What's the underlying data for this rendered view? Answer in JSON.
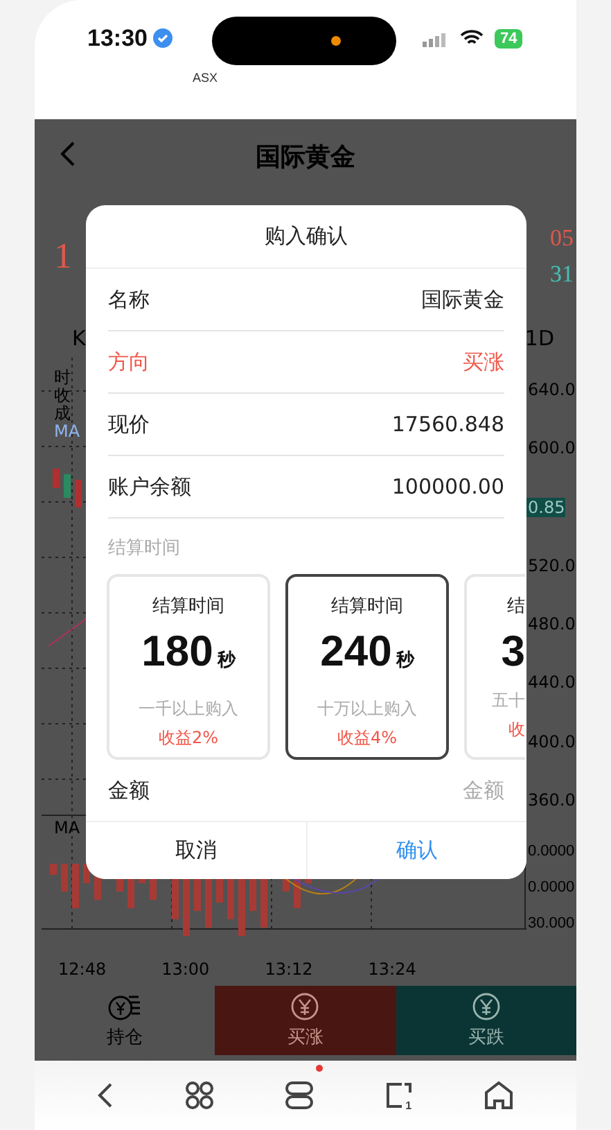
{
  "status_bar": {
    "time": "13:30",
    "battery": "74",
    "carrier_label": "ASX"
  },
  "background": {
    "title": "国际黄金",
    "price_fragment": "1",
    "change_fragments": [
      {
        "text": "05",
        "color": "#e0584c"
      },
      {
        "text": "31",
        "color": "#45c0b4"
      }
    ],
    "period_left": "K",
    "period_right": "1D",
    "info_labels": [
      "时",
      "收",
      "成",
      "MA"
    ],
    "axis_upper": [
      {
        "text": "640.0",
        "kind": "plain"
      },
      {
        "text": "600.0",
        "kind": "plain"
      },
      {
        "text": "0.85",
        "kind": "tag"
      },
      {
        "text": "520.0",
        "kind": "plain"
      },
      {
        "text": "480.0",
        "kind": "plain"
      },
      {
        "text": "440.0",
        "kind": "plain"
      },
      {
        "text": "400.0",
        "kind": "plain"
      },
      {
        "text": "360.0",
        "kind": "plain"
      }
    ],
    "axis_lower": [
      "0.0000",
      "0.0000",
      "30.000"
    ],
    "lower_label": "MA",
    "times": [
      "12:48",
      "13:00",
      "13:12",
      "13:24"
    ],
    "actions": [
      {
        "label": "持仓",
        "kind": "holdings"
      },
      {
        "label": "买涨",
        "kind": "up"
      },
      {
        "label": "买跌",
        "kind": "down"
      }
    ]
  },
  "dialog": {
    "title": "购入确认",
    "rows": [
      {
        "label": "名称",
        "value": "国际黄金",
        "highlight": false
      },
      {
        "label": "方向",
        "value": "买涨",
        "highlight": true
      },
      {
        "label": "现价",
        "value": "17560.848",
        "highlight": false
      },
      {
        "label": "账户余额",
        "value": "100000.00",
        "highlight": false
      }
    ],
    "section_label": "结算时间",
    "options": [
      {
        "kind": "full",
        "title": "结算时间",
        "value": "180",
        "unit": "秒",
        "condition": "一千以上购入",
        "yield": "收益2%",
        "selected": false
      },
      {
        "kind": "full",
        "title": "结算时间",
        "value": "240",
        "unit": "秒",
        "condition": "十万以上购入",
        "yield": "收益4%",
        "selected": true
      },
      {
        "kind": "cut",
        "title": "结",
        "value": "3",
        "condition": "五十",
        "yield": "收",
        "selected": false
      }
    ],
    "amount": {
      "label": "金额",
      "placeholder": "金额"
    },
    "buttons": [
      {
        "label": "取消",
        "kind": "cancel"
      },
      {
        "label": "确认",
        "kind": "confirm"
      }
    ]
  },
  "nav": {
    "recent_count": "1"
  }
}
